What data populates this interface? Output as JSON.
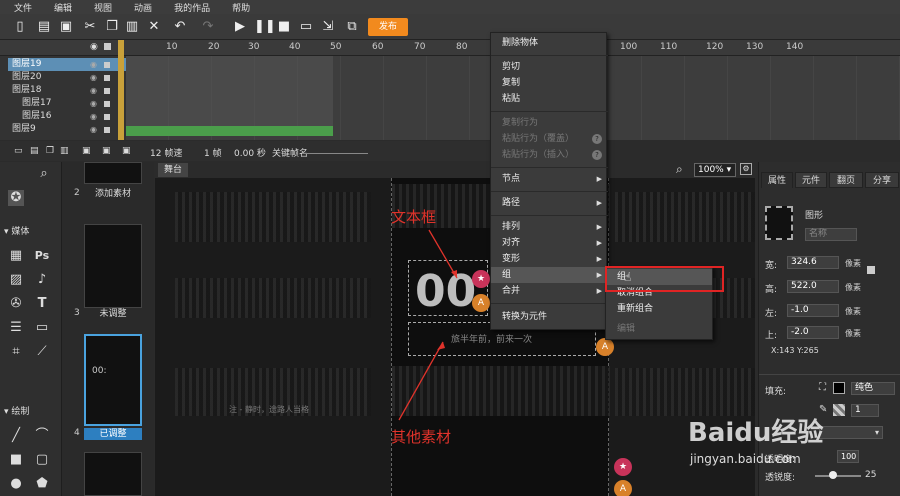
{
  "menu": [
    "文件",
    "编辑",
    "视图",
    "动画",
    "我的作品",
    "帮助"
  ],
  "toolbar": {
    "publish_label": "发布"
  },
  "timeline": {
    "ruler": [
      "10",
      "20",
      "30",
      "40",
      "50",
      "60",
      "70",
      "80",
      "90",
      "100",
      "110",
      "120",
      "130",
      "140"
    ],
    "layers": [
      "图层19",
      "图层20",
      "图层18",
      "图层17",
      "图层16",
      "图层9"
    ],
    "footer": {
      "fps": "12 帧速",
      "frame": "1 帧",
      "time": "0.00 秒",
      "keyframe_label": "关键帧名"
    }
  },
  "left_tools": {
    "media_label": "媒体",
    "draw_label": "绘制"
  },
  "thumbs": [
    {
      "num": "2",
      "label": "添加素材"
    },
    {
      "num": "3",
      "label": "未调整"
    },
    {
      "num": "4",
      "label": "已调整"
    }
  ],
  "canvas": {
    "tab": "舞台",
    "zoom": "100%",
    "big_text": "00",
    "subtitle_text": "旅半年前，前来一次",
    "caption_left": "注 - 静时，途路人当格",
    "annotation_text": "文本框",
    "annotation_other": "其他素材"
  },
  "context_menu": {
    "items": [
      {
        "label": "删除物体",
        "disabled": false,
        "submenu": false
      },
      {
        "label": "剪切",
        "disabled": false,
        "submenu": false
      },
      {
        "label": "复制",
        "disabled": false,
        "submenu": false
      },
      {
        "label": "粘贴",
        "disabled": false,
        "submenu": false
      },
      {
        "label": "复制行为",
        "disabled": true,
        "submenu": false
      },
      {
        "label": "粘贴行为（覆盖）",
        "disabled": true,
        "submenu": false
      },
      {
        "label": "粘贴行为（插入）",
        "disabled": true,
        "submenu": false
      },
      {
        "label": "节点",
        "disabled": false,
        "submenu": true
      },
      {
        "label": "路径",
        "disabled": false,
        "submenu": true
      },
      {
        "label": "排列",
        "disabled": false,
        "submenu": true
      },
      {
        "label": "对齐",
        "disabled": false,
        "submenu": true
      },
      {
        "label": "变形",
        "disabled": false,
        "submenu": true
      },
      {
        "label": "组",
        "disabled": false,
        "submenu": true
      },
      {
        "label": "合并",
        "disabled": false,
        "submenu": true
      },
      {
        "label": "转换为元件",
        "disabled": false,
        "submenu": false
      }
    ],
    "group_submenu": [
      "组",
      "取消组合",
      "重新组合",
      "编辑"
    ]
  },
  "properties": {
    "tabs": [
      "属性",
      "元件",
      "翻页",
      "分享"
    ],
    "type_label": "图形",
    "name_placeholder": "名称",
    "width_label": "宽:",
    "width_value": "324.6",
    "width_unit": "像素",
    "height_label": "高:",
    "height_value": "522.0",
    "height_unit": "像素",
    "left_label": "左:",
    "left_value": "-1.0",
    "left_unit": "像素",
    "top_label": "上:",
    "top_value": "-2.0",
    "top_unit": "像素",
    "coords": "X:143   Y:265",
    "fill_label": "填充:",
    "fill_value": "纯色",
    "stroke_value": "1",
    "opacity_label": "透明度:",
    "opacity_value": "100",
    "blur_label": "透锐度:",
    "blur_value": "25"
  },
  "watermark": {
    "brand": "Baidu经验",
    "url": "jingyan.baidu.com"
  },
  "colors": {
    "accent": "#f28a1e",
    "selection": "#5d8fb5",
    "highlight_box": "#e02424",
    "annotation": "#e0332b"
  }
}
